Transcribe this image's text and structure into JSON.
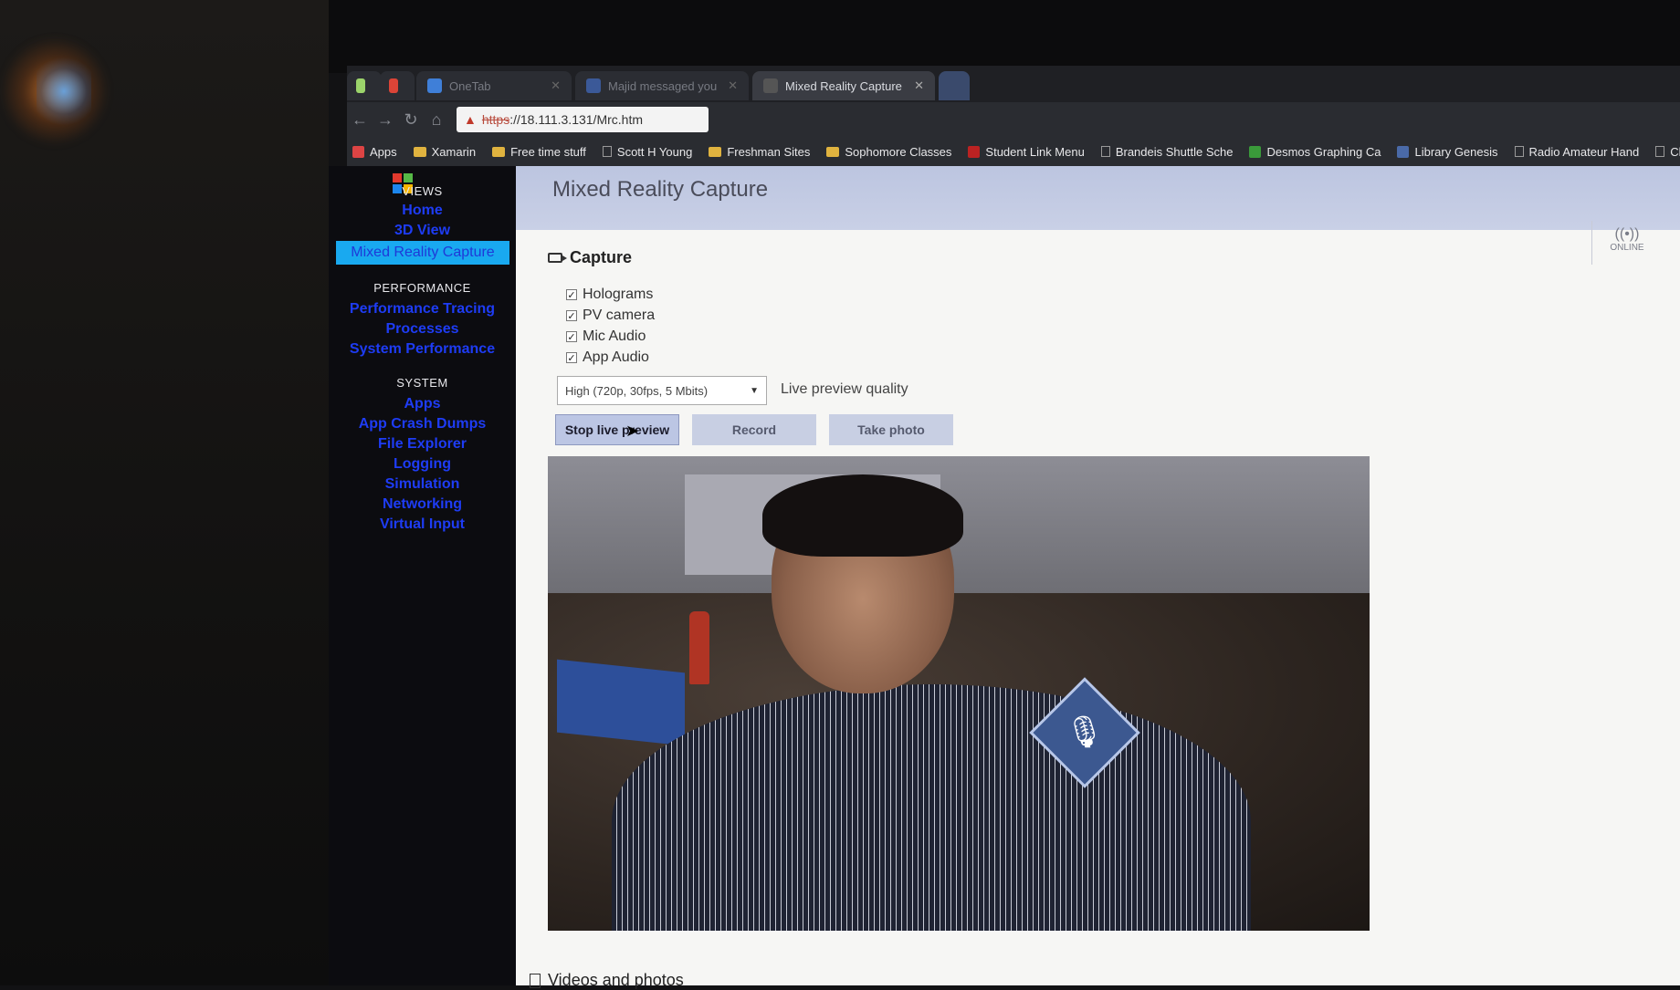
{
  "browser": {
    "tabs": [
      {
        "label": "",
        "color": "#9bd36b"
      },
      {
        "label": "",
        "color": "#db4437"
      },
      {
        "label": "OneTab",
        "color": "#3f7fd8"
      },
      {
        "label": "Majid messaged you",
        "color": "#3b5998"
      },
      {
        "label": "Mixed Reality Capture",
        "color": "#555555"
      }
    ],
    "url": {
      "scheme": "https",
      "rest": "://18.111.3.131/Mrc.htm"
    },
    "bookmarks": [
      {
        "label": "Apps",
        "type": "apps"
      },
      {
        "label": "Xamarin",
        "type": "folder"
      },
      {
        "label": "Free time stuff",
        "type": "folder"
      },
      {
        "label": "Scott H Young",
        "type": "page"
      },
      {
        "label": "Freshman Sites",
        "type": "folder"
      },
      {
        "label": "Sophomore Classes",
        "type": "folder"
      },
      {
        "label": "Student Link Menu",
        "type": "site"
      },
      {
        "label": "Brandeis Shuttle Sche",
        "type": "page"
      },
      {
        "label": "Desmos Graphing Ca",
        "type": "site"
      },
      {
        "label": "Library Genesis",
        "type": "site"
      },
      {
        "label": "Radio Amateur Hand",
        "type": "page"
      },
      {
        "label": "Cloud",
        "type": "page"
      }
    ]
  },
  "sidebar": {
    "sections": [
      {
        "title": "VIEWS",
        "items": [
          "Home",
          "3D View",
          "Mixed Reality Capture"
        ]
      },
      {
        "title": "PERFORMANCE",
        "items": [
          "Performance Tracing",
          "Processes",
          "System Performance"
        ]
      },
      {
        "title": "SYSTEM",
        "items": [
          "Apps",
          "App Crash Dumps",
          "File Explorer",
          "Logging",
          "Simulation",
          "Networking",
          "Virtual Input"
        ]
      }
    ],
    "active_item": "Mixed Reality Capture"
  },
  "header": {
    "title": "Mixed Reality Capture",
    "status": "ONLINE"
  },
  "capture": {
    "heading": "Capture",
    "checkboxes": [
      {
        "label": "Holograms",
        "checked": true
      },
      {
        "label": "PV camera",
        "checked": true
      },
      {
        "label": "Mic Audio",
        "checked": true
      },
      {
        "label": "App Audio",
        "checked": true
      }
    ],
    "quality_value": "High (720p, 30fps, 5 Mbits)",
    "quality_label": "Live preview quality",
    "buttons": {
      "stop": "Stop live preview",
      "record": "Record",
      "photo": "Take photo"
    }
  },
  "videos_heading": "Videos and photos",
  "colors": {
    "active_nav": "#19a9f0",
    "nav_link": "#1e3cf5",
    "header": "#c4cbe3"
  }
}
